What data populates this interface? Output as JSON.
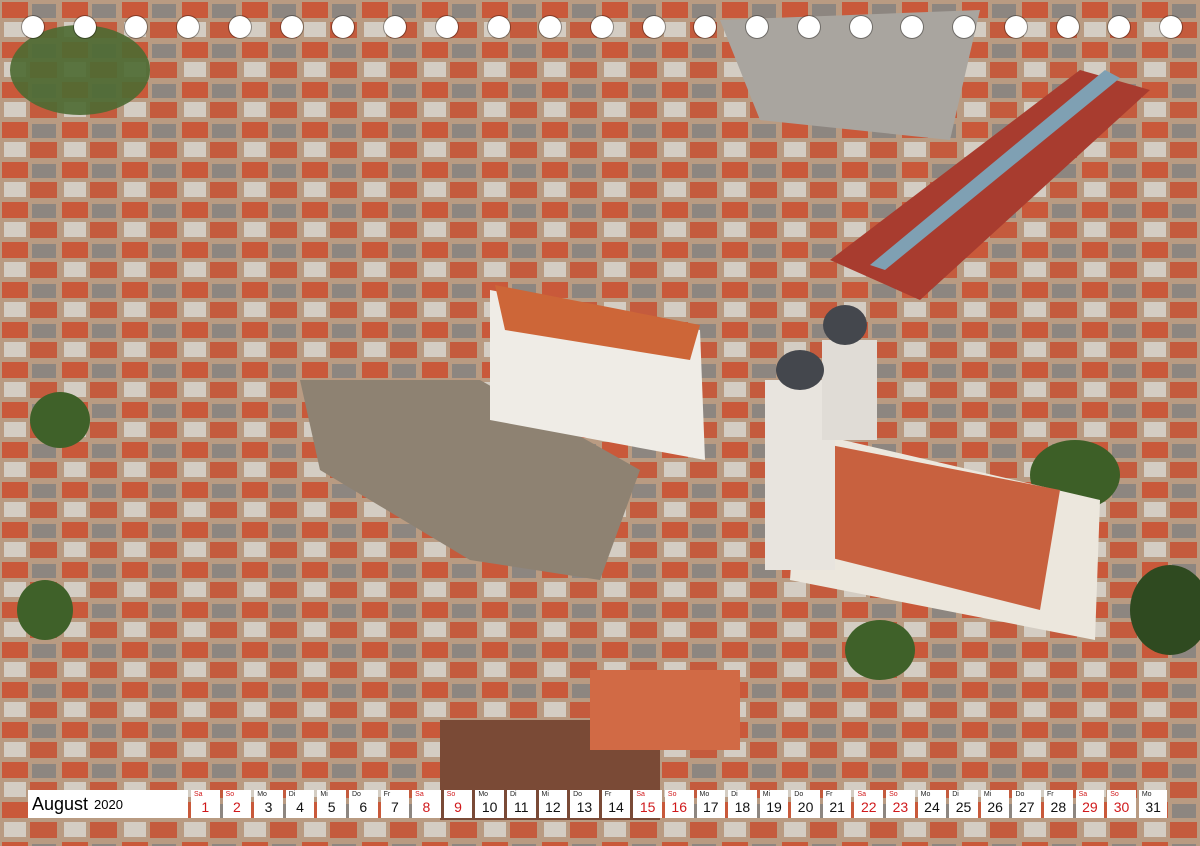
{
  "calendar": {
    "month": "August",
    "year": "2020",
    "days": [
      {
        "wd": "Sa",
        "num": "1",
        "weekend": true
      },
      {
        "wd": "So",
        "num": "2",
        "weekend": true
      },
      {
        "wd": "Mo",
        "num": "3",
        "weekend": false
      },
      {
        "wd": "Di",
        "num": "4",
        "weekend": false
      },
      {
        "wd": "Mi",
        "num": "5",
        "weekend": false
      },
      {
        "wd": "Do",
        "num": "6",
        "weekend": false
      },
      {
        "wd": "Fr",
        "num": "7",
        "weekend": false
      },
      {
        "wd": "Sa",
        "num": "8",
        "weekend": true
      },
      {
        "wd": "So",
        "num": "9",
        "weekend": true
      },
      {
        "wd": "Mo",
        "num": "10",
        "weekend": false
      },
      {
        "wd": "Di",
        "num": "11",
        "weekend": false
      },
      {
        "wd": "Mi",
        "num": "12",
        "weekend": false
      },
      {
        "wd": "Do",
        "num": "13",
        "weekend": false
      },
      {
        "wd": "Fr",
        "num": "14",
        "weekend": false
      },
      {
        "wd": "Sa",
        "num": "15",
        "weekend": true
      },
      {
        "wd": "So",
        "num": "16",
        "weekend": true
      },
      {
        "wd": "Mo",
        "num": "17",
        "weekend": false
      },
      {
        "wd": "Di",
        "num": "18",
        "weekend": false
      },
      {
        "wd": "Mi",
        "num": "19",
        "weekend": false
      },
      {
        "wd": "Do",
        "num": "20",
        "weekend": false
      },
      {
        "wd": "Fr",
        "num": "21",
        "weekend": false
      },
      {
        "wd": "Sa",
        "num": "22",
        "weekend": true
      },
      {
        "wd": "So",
        "num": "23",
        "weekend": true
      },
      {
        "wd": "Mo",
        "num": "24",
        "weekend": false
      },
      {
        "wd": "Di",
        "num": "25",
        "weekend": false
      },
      {
        "wd": "Mi",
        "num": "26",
        "weekend": false
      },
      {
        "wd": "Do",
        "num": "27",
        "weekend": false
      },
      {
        "wd": "Fr",
        "num": "28",
        "weekend": false
      },
      {
        "wd": "Sa",
        "num": "29",
        "weekend": true
      },
      {
        "wd": "So",
        "num": "30",
        "weekend": true
      },
      {
        "wd": "Mo",
        "num": "31",
        "weekend": false
      }
    ]
  },
  "binding_holes": 23,
  "colors": {
    "weekend": "#d0191b",
    "roof": "#c9593a",
    "square": "#8e8272"
  },
  "photo": {
    "description_icon": "aerial-town-photo"
  }
}
